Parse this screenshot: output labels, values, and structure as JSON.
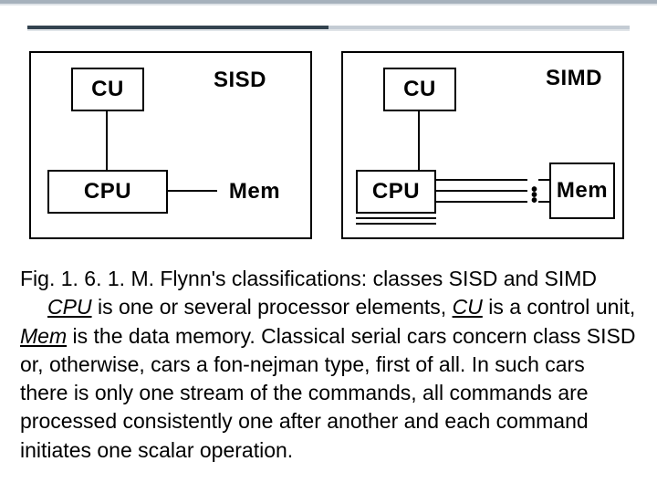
{
  "labels": {
    "cu": "CU",
    "cpu": "CPU",
    "mem": "Mem",
    "sisd": "SISD",
    "simd": "SIMD"
  },
  "caption": {
    "line1_a": "Fig. 1. 6. 1. M. Flynn's classifications: classes SISD and SIMD",
    "cpu_em": "CPU",
    "line2_a": " is one or several processor elements, ",
    "cu_em": "CU",
    "line2_b": " is a control",
    "line3_a": "unit, ",
    "mem_em": "Mem",
    "line3_b": " is the data memory. Classical serial cars concern class SISD or, otherwise, cars a fon-nejman type, first of all. In such cars there is only one stream of the commands, all commands are processed consistently one after another and each command initiates one scalar operation."
  }
}
